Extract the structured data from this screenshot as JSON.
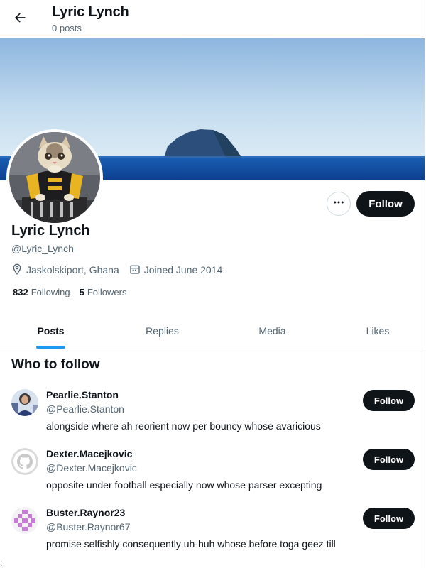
{
  "header": {
    "title": "Lyric Lynch",
    "post_count": "0 posts"
  },
  "profile": {
    "name": "Lyric Lynch",
    "handle": "@Lyric_Lynch",
    "location": "Jaskolskiport, Ghana",
    "joined": "Joined June 2014",
    "following_count": "832",
    "following_label": "Following",
    "followers_count": "5",
    "followers_label": "Followers",
    "follow_label": "Follow",
    "more_icon": "more-horizontal-icon"
  },
  "tabs": [
    {
      "label": "Posts",
      "active": true
    },
    {
      "label": "Replies",
      "active": false
    },
    {
      "label": "Media",
      "active": false
    },
    {
      "label": "Likes",
      "active": false
    }
  ],
  "who_to_follow": {
    "title": "Who to follow",
    "users": [
      {
        "name": "Pearlie.Stanton",
        "handle": "@Pearlie.Stanton",
        "bio": "alongside where ah reorient now per bouncy whose avaricious",
        "follow_label": "Follow"
      },
      {
        "name": "Dexter.Macejkovic",
        "handle": "@Dexter.Macejkovic",
        "bio": "opposite under football especially now whose parser excepting",
        "follow_label": "Follow"
      },
      {
        "name": "Buster.Raynor23",
        "handle": "@Buster.Raynor67",
        "bio": "promise selfishly consequently uh-huh whose before toga geez till",
        "follow_label": "Follow"
      }
    ]
  },
  "footer_mark": ":",
  "colors": {
    "accent": "#1d9bf0",
    "text": "#0f1419",
    "muted": "#536471",
    "button_dark": "#0f1419"
  }
}
